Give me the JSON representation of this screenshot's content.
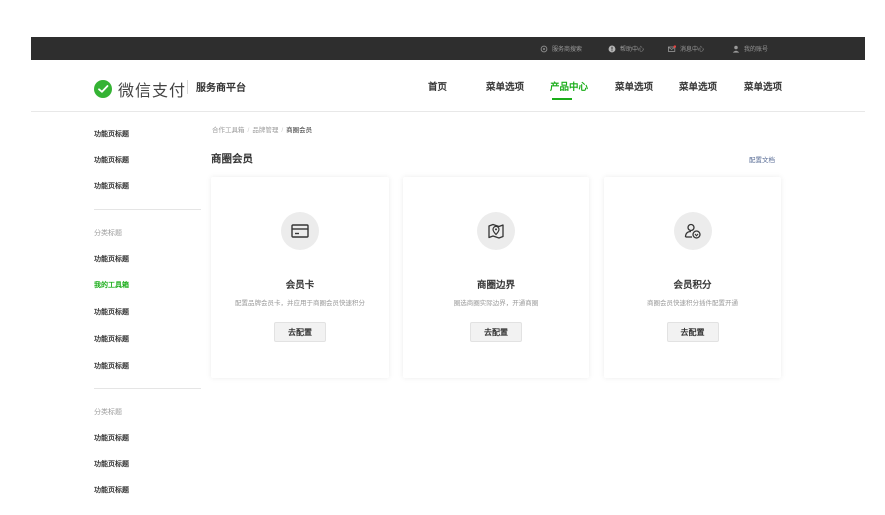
{
  "topbar": {
    "links": [
      {
        "label": "服务商搜索",
        "icon": "search-icon"
      },
      {
        "label": "帮助中心",
        "icon": "help-icon"
      },
      {
        "label": "消息中心",
        "icon": "mail-icon"
      },
      {
        "label": "我的账号",
        "icon": "user-icon"
      }
    ]
  },
  "header": {
    "brand": "微信支付",
    "platform": "服务商平台",
    "nav": [
      {
        "label": "首页"
      },
      {
        "label": "菜单选项"
      },
      {
        "label": "产品中心",
        "active": true
      },
      {
        "label": "菜单选项"
      },
      {
        "label": "菜单选项"
      },
      {
        "label": "菜单选项"
      }
    ]
  },
  "sidebar": {
    "group1": [
      "功能页标题",
      "功能页标题",
      "功能页标题"
    ],
    "cat2": "分类标题",
    "group2": [
      "功能页标题",
      "我的工具箱",
      "功能页标题",
      "功能页标题",
      "功能页标题"
    ],
    "cat3": "分类标题",
    "group3": [
      "功能页标题",
      "功能页标题",
      "功能页标题"
    ]
  },
  "main": {
    "breadcrumb": [
      "合作工具箱",
      "品牌管理",
      "商圈会员"
    ],
    "title": "商圈会员",
    "doc_link": "配置文档",
    "cards": [
      {
        "icon": "card-icon",
        "title": "会员卡",
        "desc": "配置品牌会员卡，并应用于商圈会员快速积分",
        "button": "去配置"
      },
      {
        "icon": "map-location-icon",
        "title": "商圈边界",
        "desc": "圈选商圈实际边界，开通商圈",
        "button": "去配置"
      },
      {
        "icon": "member-points-icon",
        "title": "会员积分",
        "desc": "商圈会员快速积分插件配置开通",
        "button": "去配置"
      }
    ]
  },
  "colors": {
    "accent": "#1aad19",
    "topbar": "#2e2e2e",
    "link": "#576b95"
  }
}
